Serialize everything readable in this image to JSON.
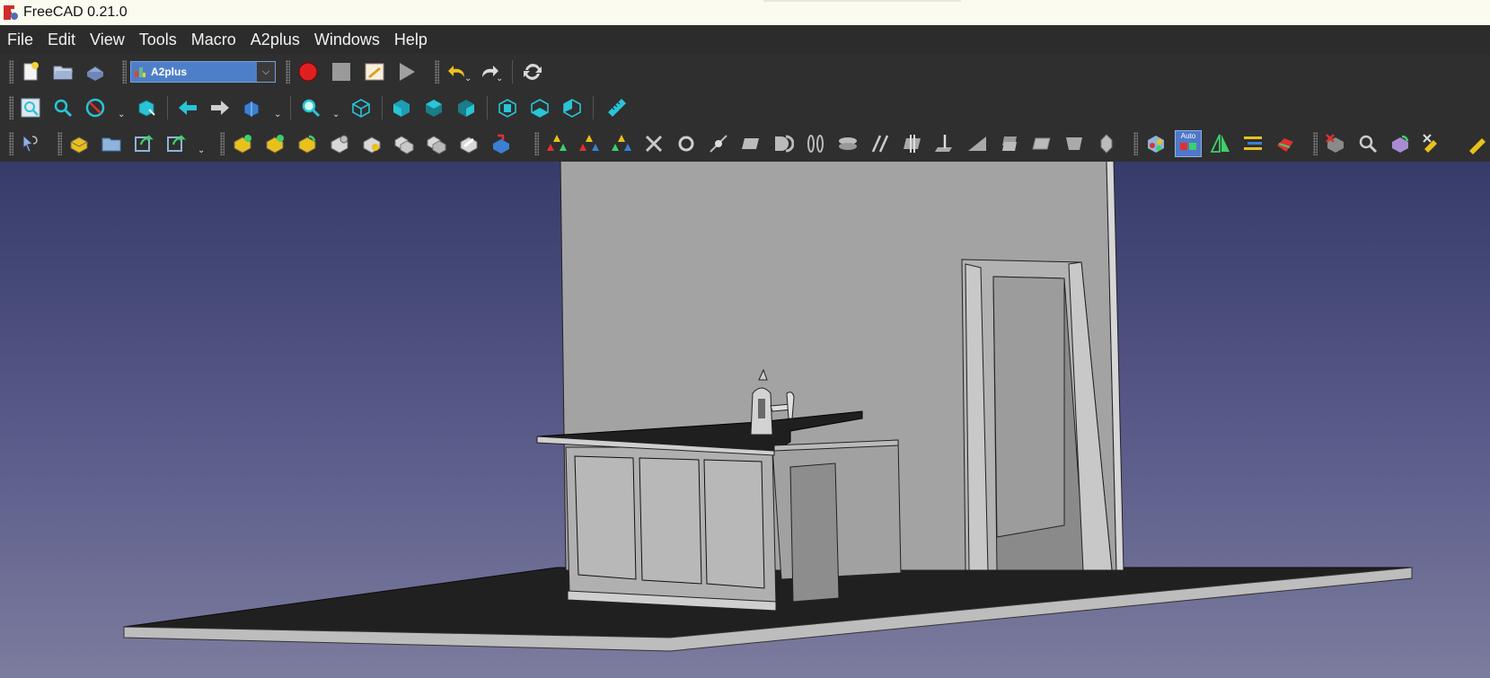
{
  "window": {
    "title": "FreeCAD 0.21.0"
  },
  "menu": {
    "items": [
      "File",
      "Edit",
      "View",
      "Tools",
      "Macro",
      "A2plus",
      "Windows",
      "Help"
    ]
  },
  "workbench_selector": {
    "value": "A2plus"
  },
  "toolbar": {
    "auto_label": "Auto"
  },
  "colors": {
    "viewport_top": "#373b6a",
    "viewport_bottom": "#7c7c9e",
    "toolbar_bg": "#2f2f2f",
    "workbench_blue": "#4d7fc9",
    "record_red": "#e02020",
    "icon_cyan": "#29c4d6",
    "icon_yellow": "#e8c11c"
  }
}
